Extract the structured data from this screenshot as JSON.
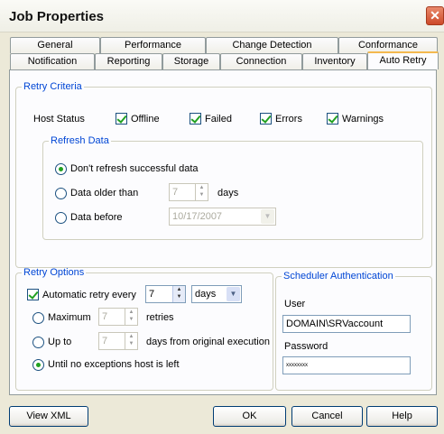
{
  "window": {
    "title": "Job Properties"
  },
  "tabs": {
    "row1": [
      "General",
      "Performance",
      "Change Detection",
      "Conformance"
    ],
    "row2": [
      "Notification",
      "Reporting",
      "Storage",
      "Connection",
      "Inventory",
      "Auto Retry"
    ],
    "active": "Auto Retry"
  },
  "retry_criteria": {
    "legend": "Retry Criteria",
    "host_status_label": "Host Status",
    "statuses": [
      {
        "label": "Offline",
        "checked": true
      },
      {
        "label": "Failed",
        "checked": true
      },
      {
        "label": "Errors",
        "checked": true
      },
      {
        "label": "Warnings",
        "checked": true
      }
    ],
    "refresh": {
      "legend": "Refresh Data",
      "option_dont": "Don't refresh successful data",
      "option_older": "Data older than",
      "older_value": "7",
      "older_unit": "days",
      "option_before": "Data before",
      "before_value": "10/17/2007",
      "selected": "Don't refresh successful data"
    }
  },
  "retry_options": {
    "legend": "Retry Options",
    "auto_label": "Automatic retry every",
    "auto_value": "7",
    "auto_unit": "days",
    "auto_checked": true,
    "maximum_label": "Maximum",
    "maximum_value": "7",
    "maximum_unit": "retries",
    "upto_label": "Up to",
    "upto_value": "7",
    "upto_unit": "days from original execution",
    "until_label": "Until no exceptions host is left",
    "selected": "Until no exceptions host is left"
  },
  "scheduler": {
    "legend": "Scheduler Authentication",
    "user_label": "User",
    "user_value": "DOMAIN\\SRVaccount",
    "password_label": "Password",
    "password_value": "xxxxxxxx"
  },
  "buttons": {
    "view_xml": "View XML",
    "ok": "OK",
    "cancel": "Cancel",
    "help": "Help"
  }
}
